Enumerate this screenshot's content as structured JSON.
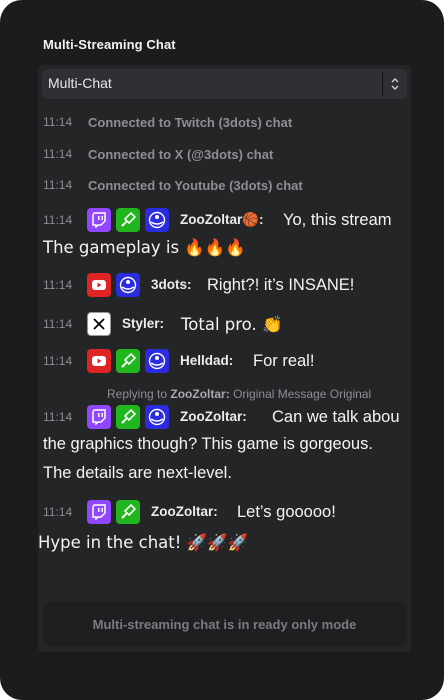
{
  "panel": {
    "title": "Multi-Streaming Chat"
  },
  "selector": {
    "value": "Multi-Chat"
  },
  "system_messages": [
    {
      "time": "11:14",
      "text": "Connected to Twitch (3dots) chat"
    },
    {
      "time": "11:14",
      "text": "Connected to X (@3dots) chat"
    },
    {
      "time": "11:14",
      "text": "Connected to Youtube (3dots) chat"
    }
  ],
  "messages": [
    {
      "time": "11:14",
      "badges": [
        "twitch-icon",
        "kick-icon",
        "three-dots-icon"
      ],
      "user": "ZooZoltar🏀:",
      "text": "Yo, this stream",
      "continuation": "The gameplay is 🔥🔥🔥"
    },
    {
      "time": "11:14",
      "badges": [
        "youtube-icon",
        "three-dots-icon"
      ],
      "user": "3dots:",
      "text": "Right?! it’s INSANE!"
    },
    {
      "time": "11:14",
      "badges": [
        "x-icon"
      ],
      "user": "Styler:",
      "text": "Total pro. 👏"
    },
    {
      "time": "11:14",
      "badges": [
        "youtube-icon",
        "kick-icon",
        "three-dots-icon"
      ],
      "user": "Helldad:",
      "text": "For real!"
    },
    {
      "reply": {
        "prefix": "Replying to",
        "user": "ZooZoltar:",
        "text": "Original Message Original"
      }
    },
    {
      "time": "11:14",
      "badges": [
        "twitch-icon",
        "kick-icon",
        "three-dots-icon"
      ],
      "user": "ZooZoltar:",
      "text": "Can we talk abou",
      "continuation1": "the graphics though? This game is gorgeous.",
      "continuation2": "The details are next-level."
    },
    {
      "time": "11:14",
      "badges": [
        "twitch-icon",
        "kick-icon"
      ],
      "user": "ZooZoltar:",
      "text": "Let’s gooooo!"
    }
  ],
  "loose_line": "Hype in the chat! 🚀🚀🚀",
  "footer": {
    "text": "Multi-streaming chat is in ready only mode"
  },
  "colors": {
    "twitch": "#9146ff",
    "kick": "#21b51e",
    "three": "#2b2be0",
    "youtube": "#e02424"
  }
}
